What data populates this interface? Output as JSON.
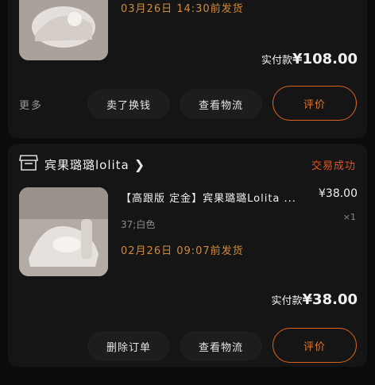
{
  "orders": [
    {
      "ship_time": "03月26日  14:30前发货",
      "paid_label": "实付款",
      "paid_amount": "¥108.00",
      "more_label": "更多",
      "buttons": [
        "卖了换钱",
        "查看物流",
        "评价"
      ]
    },
    {
      "shop_name": "宾果璐璐lolita",
      "status": "交易成功",
      "item_title": "【高跟版 定金】宾果璐璐Lolita ...",
      "item_price": "¥38.00",
      "item_qty": "×1",
      "item_spec": "37;白色",
      "ship_time": "02月26日  09:07前发货",
      "paid_label": "实付款",
      "paid_amount": "¥38.00",
      "buttons": [
        "删除订单",
        "查看物流",
        "评价"
      ]
    }
  ],
  "colors": {
    "accent_orange": "#e3762c",
    "status_red": "#e0552b",
    "ship_time": "#d08a3a"
  }
}
